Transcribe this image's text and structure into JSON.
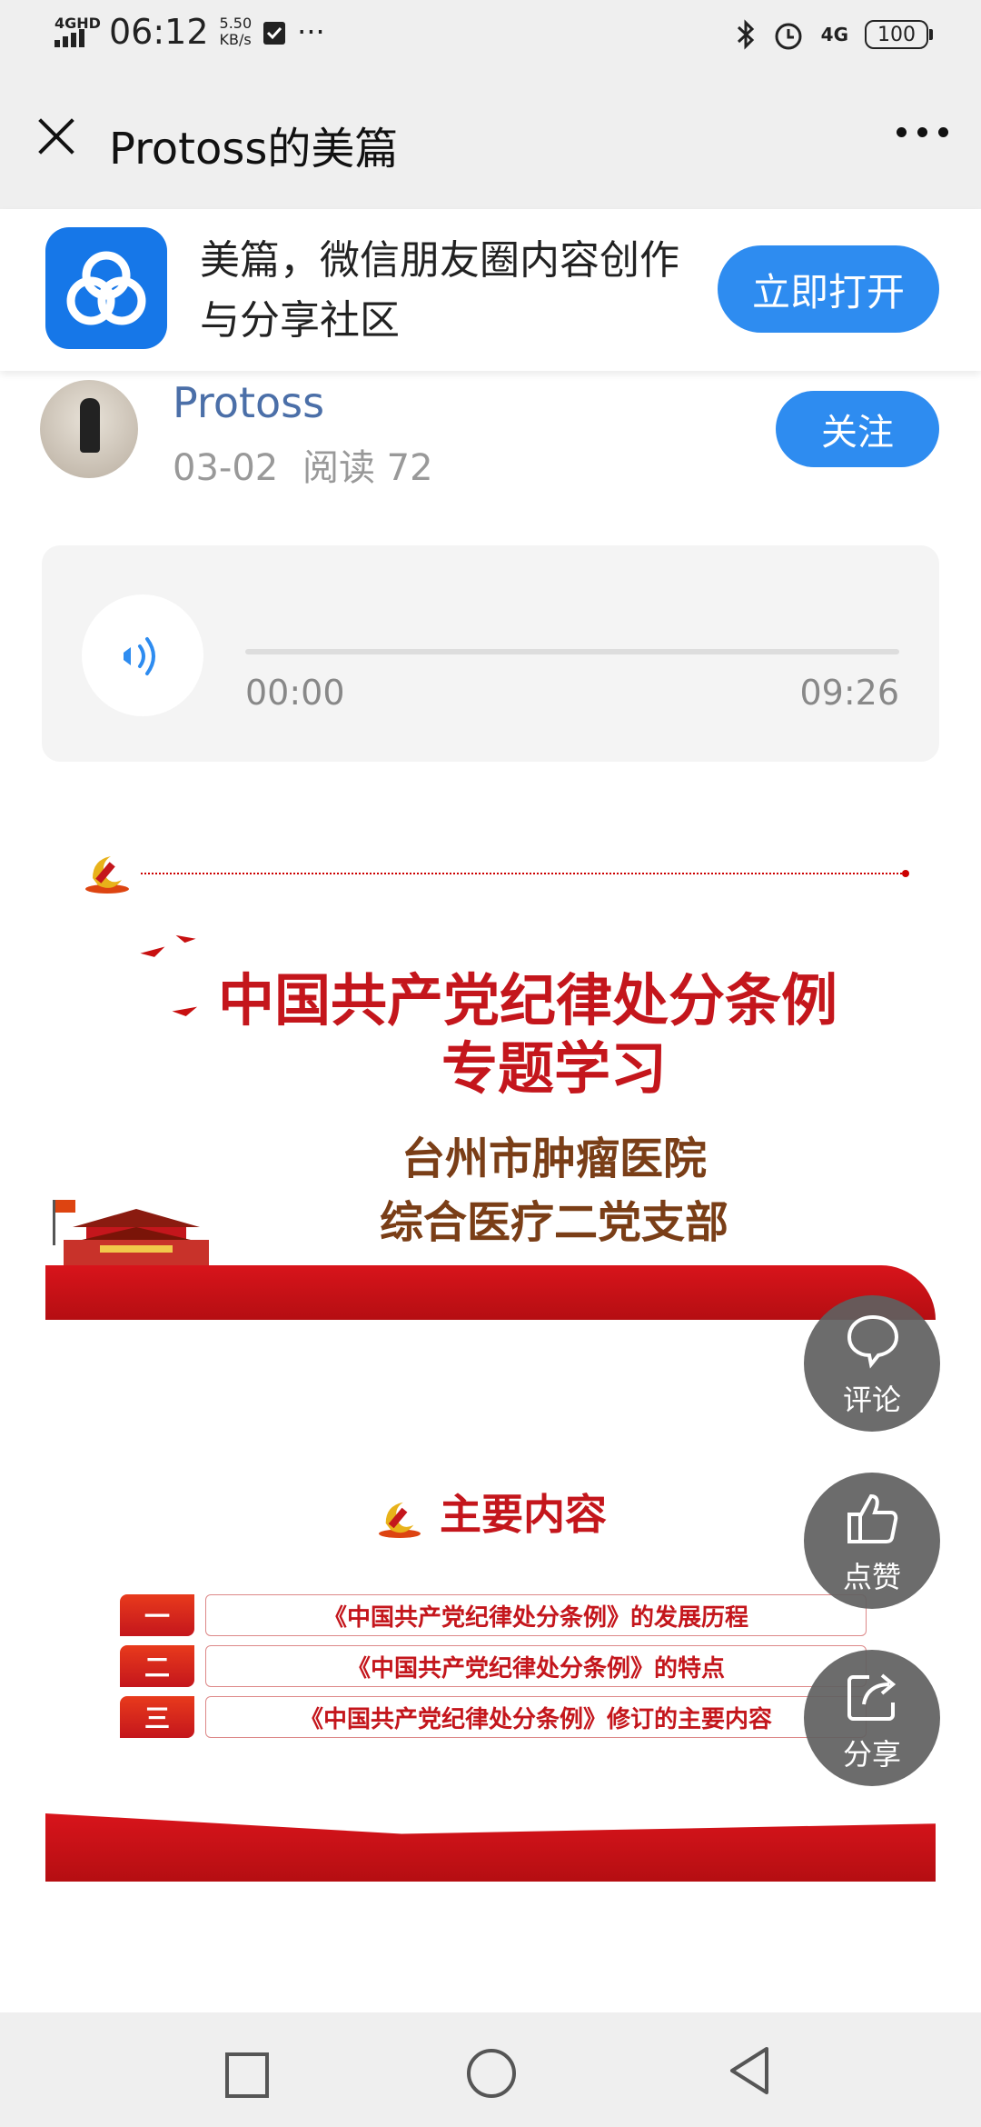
{
  "status_bar": {
    "network": "4GHD",
    "time": "06:12",
    "speed": "5.50",
    "speed_unit": "KB/s",
    "more": "···",
    "signal_right": "4G",
    "battery": "100"
  },
  "app_bar": {
    "title": "Protoss的美篇"
  },
  "banner": {
    "text": "美篇，微信朋友圈内容创作与分享社区",
    "open_button": "立即打开"
  },
  "author": {
    "name": "Protoss",
    "date": "03-02",
    "reads_label": "阅读",
    "reads": "72",
    "follow_button": "关注"
  },
  "audio": {
    "current": "00:00",
    "total": "09:26"
  },
  "slide1": {
    "title_line1": "中国共产党纪律处分条例",
    "title_line2": "专题学习",
    "org_line1": "台州市肿瘤医院",
    "org_line2": "综合医疗二党支部"
  },
  "slide2": {
    "heading": "主要内容",
    "items": [
      {
        "num": "一",
        "text": "《中国共产党纪律处分条例》的发展历程"
      },
      {
        "num": "二",
        "text": "《中国共产党纪律处分条例》的特点"
      },
      {
        "num": "三",
        "text": "《中国共产党纪律处分条例》修订的主要内容"
      }
    ]
  },
  "actions": {
    "comment": "评论",
    "like": "点赞",
    "share": "分享"
  },
  "colors": {
    "accent": "#2e8cf0",
    "party_red": "#c4161c"
  }
}
